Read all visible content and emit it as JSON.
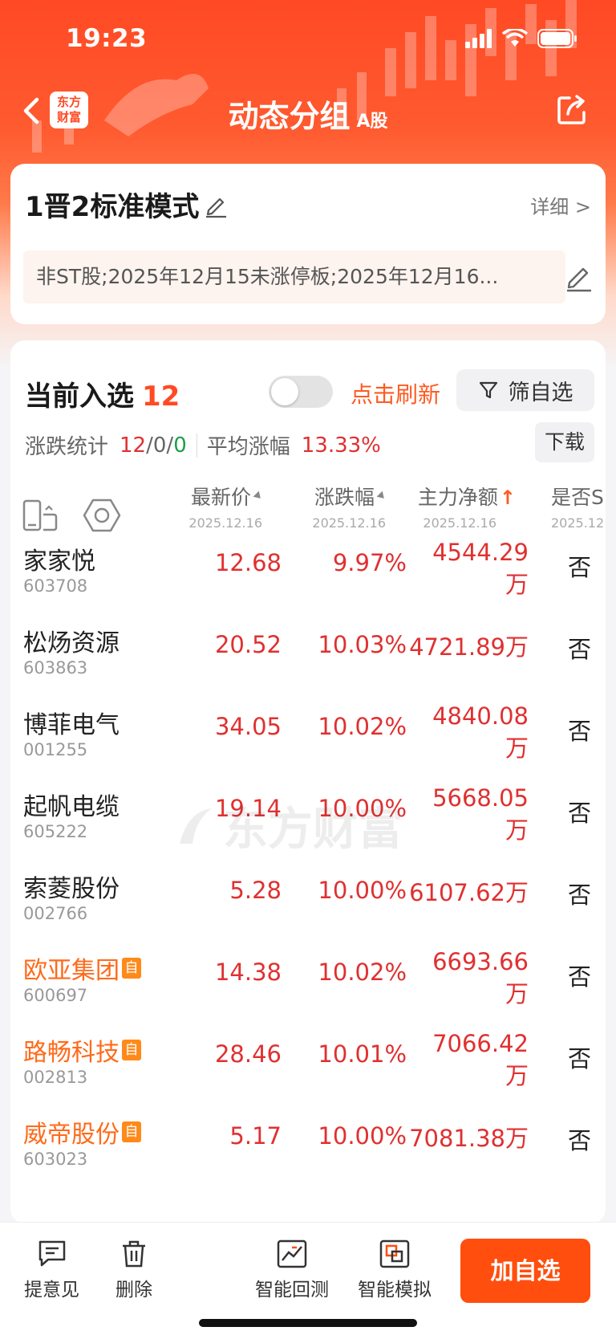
{
  "status": {
    "time": "19:23"
  },
  "nav": {
    "logo_line1": "东方",
    "logo_line2": "财富",
    "title": "动态分组",
    "subtitle": "A股"
  },
  "strategy": {
    "name": "1晋2标准模式",
    "detail": "详细 >",
    "conditions": "非ST股;2025年12月15未涨停板;2025年12月16..."
  },
  "selection": {
    "label": "当前入选",
    "count": "12",
    "refresh": "点击刷新",
    "filter": "筛自选",
    "stats_label": "涨跌统计",
    "stats_up": "12",
    "stats_flat": "0",
    "stats_down": "0",
    "slash": "/",
    "avg_label": "平均涨幅",
    "avg_value": "13.33%",
    "download": "下载",
    "toggle_on": false
  },
  "columns": {
    "price": "最新价",
    "change": "涨跌幅",
    "net": "主力净额",
    "st": "是否S",
    "date": "2025.12.16",
    "date_cut": "2025.12"
  },
  "rows": [
    {
      "name": "家家悦",
      "code": "603708",
      "price": "12.68",
      "change": "9.97%",
      "net_a": "4544.29",
      "net_b": "万",
      "st": "否",
      "self": false
    },
    {
      "name": "松炀资源",
      "code": "603863",
      "price": "20.52",
      "change": "10.03%",
      "net_a": "4721.89万",
      "net_b": "",
      "st": "否",
      "self": false
    },
    {
      "name": "博菲电气",
      "code": "001255",
      "price": "34.05",
      "change": "10.02%",
      "net_a": "4840.08",
      "net_b": "万",
      "st": "否",
      "self": false
    },
    {
      "name": "起帆电缆",
      "code": "605222",
      "price": "19.14",
      "change": "10.00%",
      "net_a": "5668.05",
      "net_b": "万",
      "st": "否",
      "self": false
    },
    {
      "name": "索菱股份",
      "code": "002766",
      "price": "5.28",
      "change": "10.00%",
      "net_a": "6107.62万",
      "net_b": "",
      "st": "否",
      "self": false
    },
    {
      "name": "欧亚集团",
      "code": "600697",
      "price": "14.38",
      "change": "10.02%",
      "net_a": "6693.66",
      "net_b": "万",
      "st": "否",
      "self": true
    },
    {
      "name": "路畅科技",
      "code": "002813",
      "price": "28.46",
      "change": "10.01%",
      "net_a": "7066.42",
      "net_b": "万",
      "st": "否",
      "self": true
    },
    {
      "name": "威帝股份",
      "code": "603023",
      "price": "5.17",
      "change": "10.00%",
      "net_a": "7081.38万",
      "net_b": "",
      "st": "否",
      "self": true
    }
  ],
  "self_badge": "自",
  "watermark": "东方财富",
  "bottom": {
    "feedback": "提意见",
    "delete": "删除",
    "backtest": "智能回测",
    "simulate": "智能模拟",
    "add": "加自选"
  },
  "colors": {
    "accent": "#ff4e0e",
    "up": "#e03030",
    "down": "#1aa04a",
    "self_stock": "#ff6a1a"
  },
  "icons": [
    "back-icon",
    "share-icon",
    "pencil-icon",
    "filter-icon",
    "phone-swap-icon",
    "hexagon-settings-icon",
    "feedback-icon",
    "trash-icon",
    "backtest-icon",
    "simulate-icon"
  ]
}
